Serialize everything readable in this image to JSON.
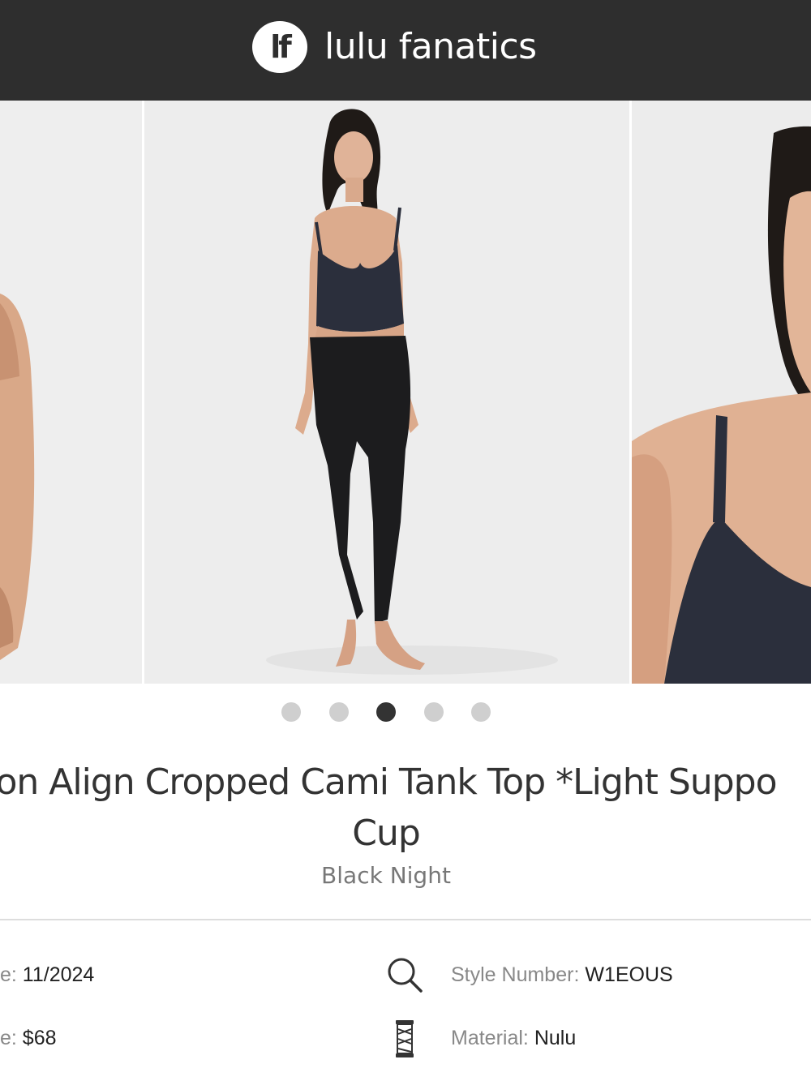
{
  "header": {
    "logo_text": "lf",
    "brand_name": "lulu fanatics"
  },
  "gallery": {
    "slide_count": 5,
    "active_index": 2
  },
  "product": {
    "title_line1": "on Align Cropped Cami Tank Top *Light Suppo",
    "title_line2": "Cup",
    "color": "Black Night"
  },
  "details": {
    "release_date": {
      "label": "e: ",
      "value": "11/2024"
    },
    "price": {
      "label": "e: ",
      "value": "$68"
    },
    "style_number": {
      "label": "Style Number: ",
      "value": "W1EOUS",
      "icon": "magnifier-icon"
    },
    "material": {
      "label": "Material: ",
      "value": "Nulu",
      "icon": "fabric-spool-icon"
    }
  },
  "colors": {
    "header_bg": "#2e2e2e",
    "dot_active": "#333333",
    "dot_inactive": "#cfcfcf",
    "top_color": "#2b2f3c",
    "legging_color": "#1c1c1e"
  }
}
